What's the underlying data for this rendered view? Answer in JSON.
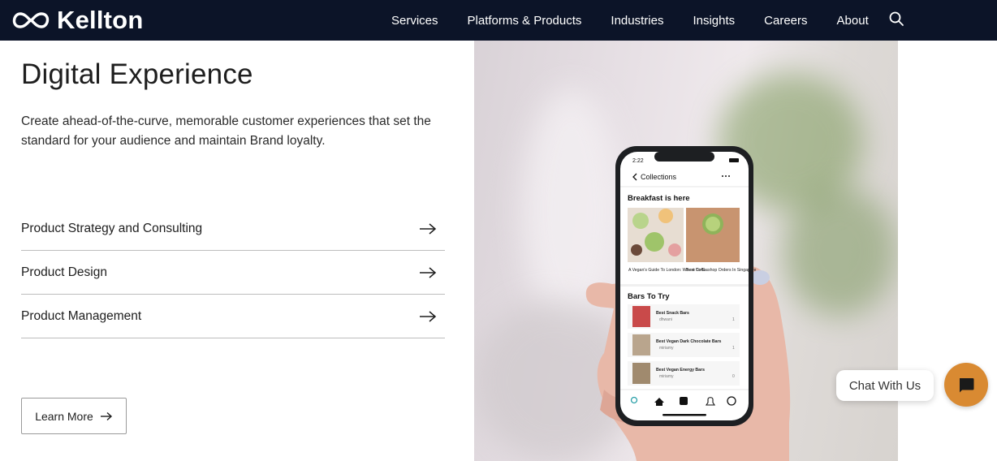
{
  "brand": {
    "name": "Kellton"
  },
  "nav": {
    "items": [
      "Services",
      "Platforms & Products",
      "Industries",
      "Insights",
      "Careers",
      "About"
    ]
  },
  "hero": {
    "title": "Digital Experience",
    "description": "Create ahead-of-the-curve, memorable customer experiences that set the standard for your audience and maintain Brand loyalty.",
    "links": [
      "Product Strategy and Consulting",
      "Product Design",
      "Product Management"
    ],
    "cta": "Learn More"
  },
  "phone": {
    "time": "2:22",
    "back_label": "Collections",
    "section1": "Breakfast is here",
    "card1_caption": "A Vegan's Guide To London: Where To G...",
    "card2_caption": "Best Coffeeshop Orders In Singapore",
    "section2": "Bars To Try",
    "rows": [
      {
        "title": "Best Snack Bars",
        "user": "dhwani",
        "likes": "1"
      },
      {
        "title": "Best Vegan Dark Chocolate Bars",
        "user": "miriamy",
        "likes": "1"
      },
      {
        "title": "Best Vegan Energy Bars",
        "user": "miriamy",
        "likes": "0"
      }
    ]
  },
  "chat": {
    "label": "Chat With Us"
  },
  "colors": {
    "nav_bg": "#0c1428",
    "chat_accent": "#d98a32",
    "divider": "#bdbdbd"
  }
}
